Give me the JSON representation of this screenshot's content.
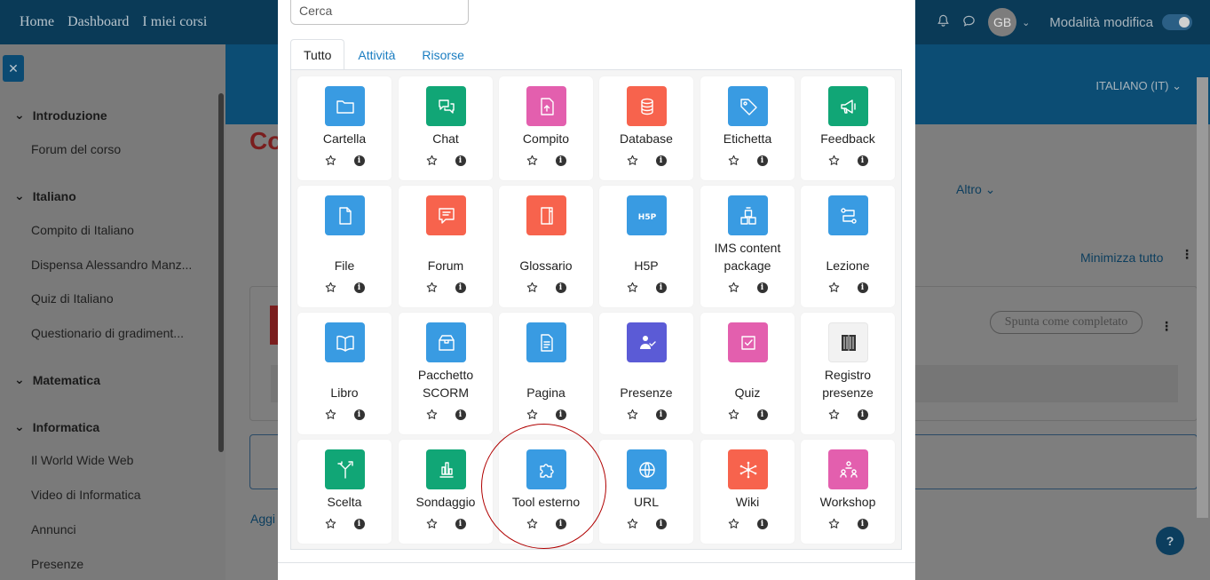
{
  "navbar": {
    "links": [
      "Home",
      "Dashboard",
      "I miei corsi"
    ],
    "avatar_initials": "GB",
    "edit_mode_label": "Modalità modifica"
  },
  "drawer": {
    "close_label": "✕",
    "sections": [
      {
        "title": "Introduzione",
        "items": [
          "Forum del corso"
        ]
      },
      {
        "title": "Italiano",
        "items": [
          "Compito di Italiano",
          "Dispensa Alessandro Manz...",
          "Quiz di Italiano",
          "Questionario di gradiment..."
        ]
      },
      {
        "title": "Matematica",
        "items": []
      },
      {
        "title": "Informatica",
        "items": [
          "Il World Wide Web",
          "Video di Informatica",
          "Annunci",
          "Presenze"
        ]
      }
    ]
  },
  "background": {
    "language": "ITALIANO (IT) ⌄",
    "title_fragment": "Co",
    "more_label": "Altro ⌄",
    "collapse_all": "Minimizza tutto",
    "mark_complete": "Spunta come completato",
    "add_fragment": "Aggi",
    "help_label": "?"
  },
  "modal": {
    "search_placeholder": "Cerca",
    "tabs": [
      "Tutto",
      "Attività",
      "Risorse"
    ],
    "activities": [
      {
        "name": "Cartella",
        "color": "#399be2",
        "icon": "folder-icon"
      },
      {
        "name": "Chat",
        "color": "#11a676",
        "icon": "chat-icon"
      },
      {
        "name": "Compito",
        "color": "#e35fae",
        "icon": "assignment-icon"
      },
      {
        "name": "Database",
        "color": "#f7634d",
        "icon": "database-icon"
      },
      {
        "name": "Etichetta",
        "color": "#399be2",
        "icon": "tag-icon"
      },
      {
        "name": "Feedback",
        "color": "#11a676",
        "icon": "megaphone-icon"
      },
      {
        "name": "File",
        "color": "#399be2",
        "icon": "file-icon"
      },
      {
        "name": "Forum",
        "color": "#f7634d",
        "icon": "forum-icon"
      },
      {
        "name": "Glossario",
        "color": "#f7634d",
        "icon": "glossary-icon"
      },
      {
        "name": "H5P",
        "color": "#399be2",
        "icon": "h5p-icon"
      },
      {
        "name": "IMS content package",
        "color": "#399be2",
        "icon": "package-icon"
      },
      {
        "name": "Lezione",
        "color": "#399be2",
        "icon": "lesson-icon"
      },
      {
        "name": "Libro",
        "color": "#399be2",
        "icon": "book-icon"
      },
      {
        "name": "Pacchetto SCORM",
        "color": "#399be2",
        "icon": "scorm-icon"
      },
      {
        "name": "Pagina",
        "color": "#399be2",
        "icon": "page-icon"
      },
      {
        "name": "Presenze",
        "color": "#5b5bd6",
        "icon": "attendance-icon"
      },
      {
        "name": "Quiz",
        "color": "#e35fae",
        "icon": "quiz-icon"
      },
      {
        "name": "Registro presenze",
        "color": "#f2f2f2",
        "icon": "register-icon"
      },
      {
        "name": "Scelta",
        "color": "#11a676",
        "icon": "choice-icon"
      },
      {
        "name": "Sondaggio",
        "color": "#11a676",
        "icon": "survey-icon"
      },
      {
        "name": "Tool esterno",
        "color": "#399be2",
        "icon": "puzzle-icon"
      },
      {
        "name": "URL",
        "color": "#399be2",
        "icon": "globe-icon"
      },
      {
        "name": "Wiki",
        "color": "#f7634d",
        "icon": "wiki-icon"
      },
      {
        "name": "Workshop",
        "color": "#e35fae",
        "icon": "workshop-icon"
      }
    ]
  }
}
